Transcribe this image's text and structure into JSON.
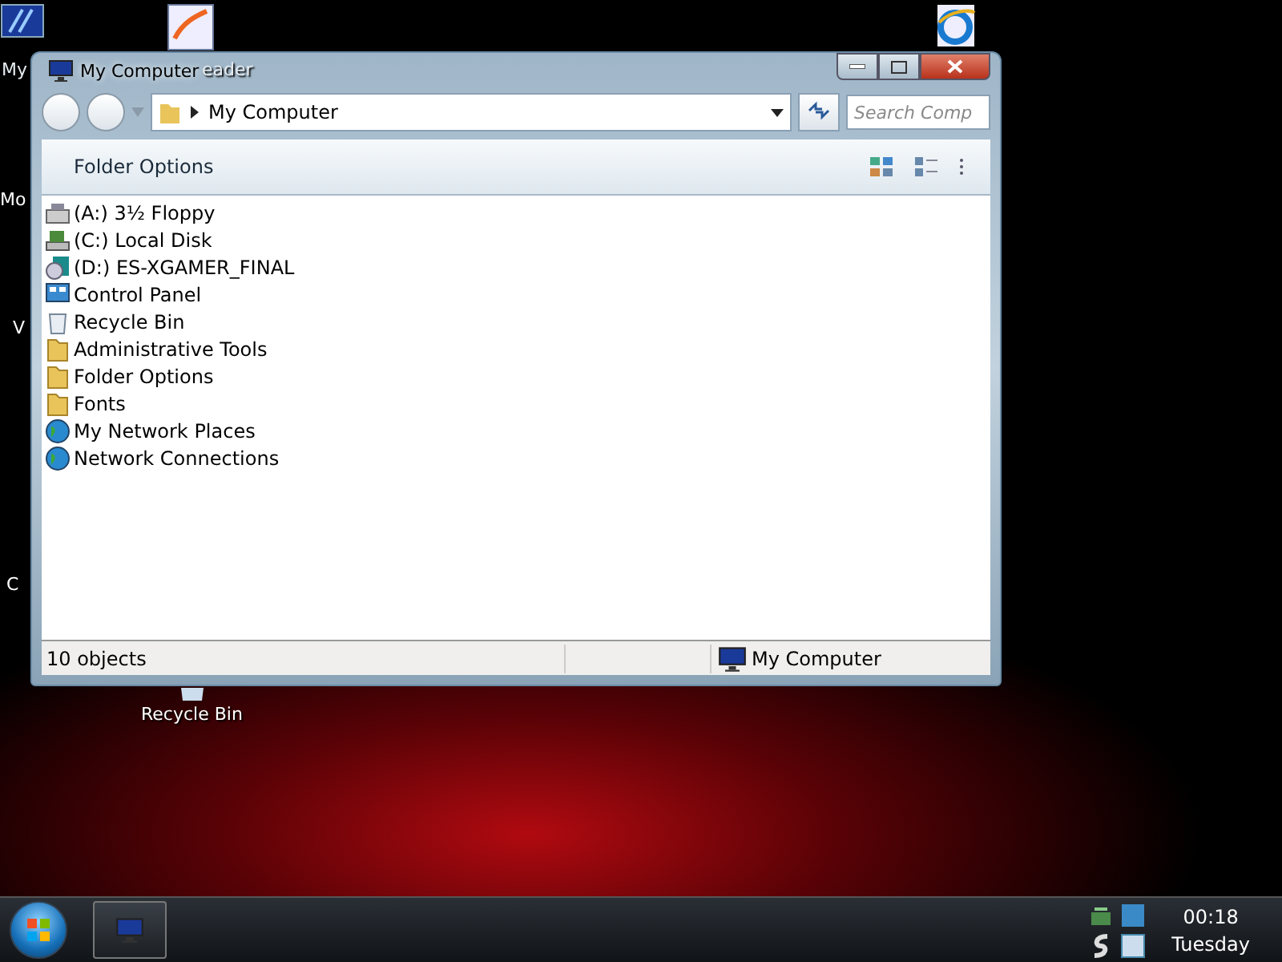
{
  "desktop_icons": [
    {
      "label": "My",
      "kind": "monitor"
    },
    {
      "label": "eader",
      "kind": "reader"
    },
    {
      "label": "Mo",
      "kind": "none"
    },
    {
      "label": "V",
      "kind": "none"
    },
    {
      "label": "C",
      "kind": "none"
    },
    {
      "label": "Recycle Bin",
      "kind": "bin"
    },
    {
      "kind": "ie"
    }
  ],
  "window": {
    "title": "My Computer",
    "address": "My Computer",
    "search": {
      "placeholder": "Search Comp"
    },
    "toolbar": [
      "Folder Options"
    ]
  },
  "items": [
    {
      "label": "(A:) 3½ Floppy",
      "kind": "floppy"
    },
    {
      "label": "(C:) Local Disk",
      "kind": "disk"
    },
    {
      "label": "(D:) ES-XGAMER_FINAL",
      "kind": "cd"
    },
    {
      "label": "Control Panel",
      "kind": "panel"
    },
    {
      "label": "Recycle Bin",
      "kind": "bin"
    },
    {
      "label": "Administrative Tools",
      "kind": "folder"
    },
    {
      "label": "Folder Options",
      "kind": "folder"
    },
    {
      "label": "Fonts",
      "kind": "folder"
    },
    {
      "label": "My Network Places",
      "kind": "globe"
    },
    {
      "label": "Network Connections",
      "kind": "globe"
    }
  ],
  "status_bar": {
    "count": "10 objects",
    "location": "My Computer"
  },
  "taskbar": {
    "time": "00:18",
    "day": "Tuesday"
  }
}
